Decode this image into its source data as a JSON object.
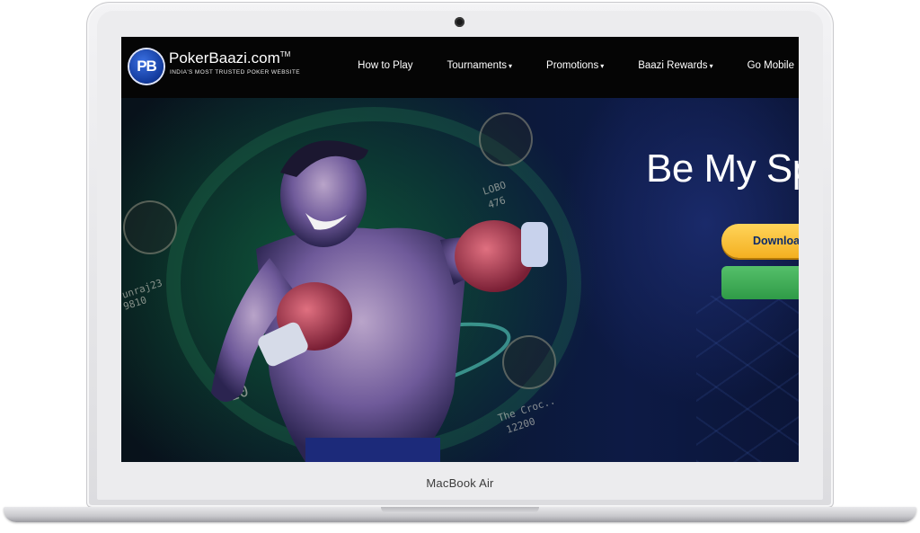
{
  "device": {
    "model_label": "MacBook Air"
  },
  "site": {
    "logo_initials": "PB",
    "logo_name": "PokerBaazi.com",
    "logo_trademark": "TM",
    "logo_tagline": "INDIA'S MOST TRUSTED POKER WEBSITE"
  },
  "nav": {
    "items": [
      {
        "label": "How to Play",
        "has_caret": false
      },
      {
        "label": "Tournaments",
        "has_caret": true
      },
      {
        "label": "Promotions",
        "has_caret": true
      },
      {
        "label": "Baazi Rewards",
        "has_caret": true
      },
      {
        "label": "Go Mobile",
        "has_caret": false
      }
    ],
    "caret_glyph": "▾"
  },
  "hero": {
    "title": "Be My Sp",
    "download_button": "Downloa",
    "seats": [
      {
        "name": "LOBO",
        "value": "476"
      },
      {
        "name": "unraj23",
        "value": "9810"
      },
      {
        "name": "The Croc..",
        "value": "12200"
      },
      {
        "name": "",
        "value": "10"
      }
    ]
  },
  "colors": {
    "nav_background": "#050505",
    "download_button": "#f4b021",
    "green_button": "#2f9b47",
    "logo_blue": "#123a9c"
  },
  "icons": {
    "logo": "pb-logo-icon",
    "camera": "camera-dot-icon",
    "dropdown": "chevron-down-icon"
  }
}
